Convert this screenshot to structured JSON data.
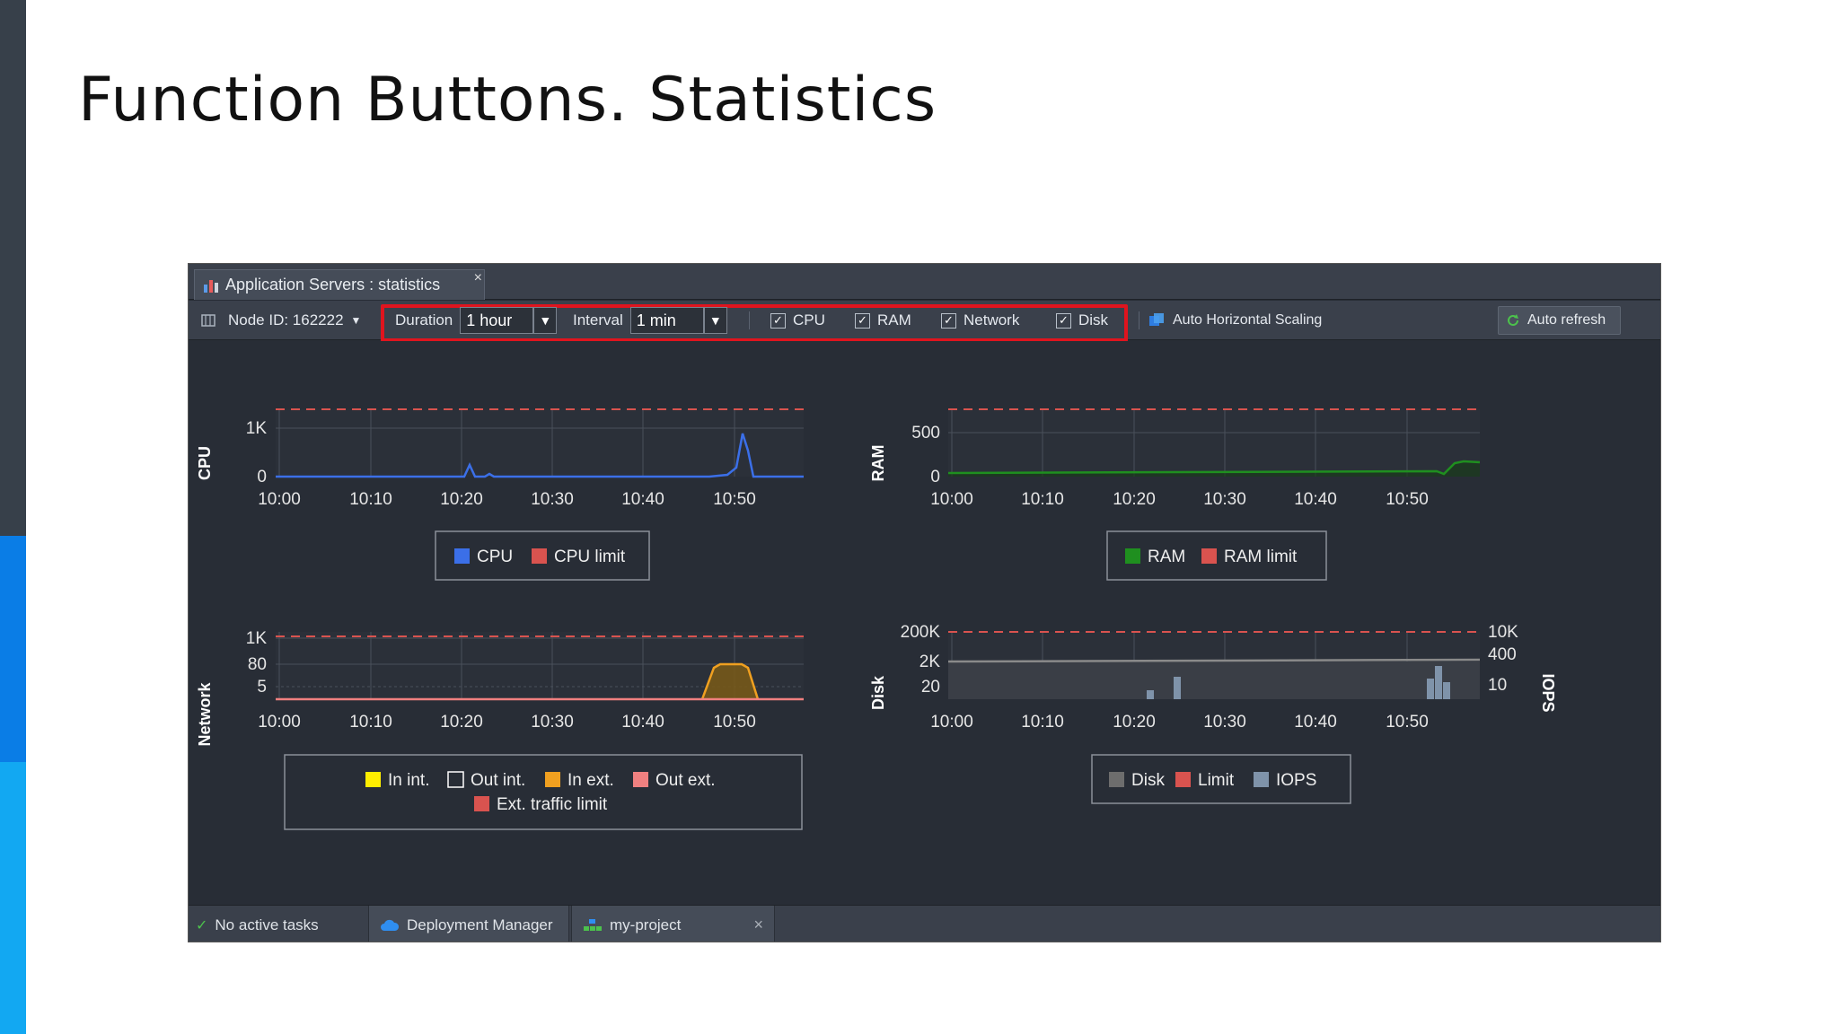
{
  "slide": {
    "title": "Function Buttons. Statistics"
  },
  "tab": {
    "label": "Application Servers : statistics",
    "close": "×"
  },
  "toolbar": {
    "node_label": "Node ID: 162222",
    "duration_label": "Duration",
    "duration_value": "1 hour",
    "interval_label": "Interval",
    "interval_value": "1 min",
    "checks": [
      "CPU",
      "RAM",
      "Network",
      "Disk"
    ],
    "scaling_label": "Auto Horizontal Scaling",
    "refresh_label": "Auto refresh"
  },
  "status": {
    "tasks": "No active tasks",
    "deploy": "Deployment Manager",
    "project": "my-project",
    "close": "×"
  },
  "colors": {
    "highlight": "#e0141e",
    "cpu": "#3b6fe8",
    "ram": "#1f8f1f",
    "limit": "#d9534f",
    "in_ext": "#f0a020",
    "in_int": "#ffee00",
    "iops": "#7f93aa",
    "disk": "#6d6d6d"
  },
  "chart_data": [
    {
      "type": "line",
      "ylabel": "CPU",
      "x": [
        "10:00",
        "10:10",
        "10:20",
        "10:30",
        "10:40",
        "10:50"
      ],
      "ticks_y": [
        "1K",
        "0"
      ],
      "series": [
        {
          "name": "CPU",
          "color": "#3b6fe8",
          "points": [
            [
              0,
              0
            ],
            [
              20,
              0
            ],
            [
              21,
              160
            ],
            [
              22,
              0
            ],
            [
              24,
              40
            ],
            [
              25,
              0
            ],
            [
              48,
              0
            ],
            [
              52,
              30
            ],
            [
              54,
              1000
            ],
            [
              55,
              0
            ],
            [
              58,
              0
            ]
          ]
        },
        {
          "name": "CPU limit",
          "color": "#d9534f",
          "style": "dashed"
        }
      ],
      "legend": [
        "CPU",
        "CPU limit"
      ]
    },
    {
      "type": "area",
      "ylabel": "RAM",
      "x": [
        "10:00",
        "10:10",
        "10:20",
        "10:30",
        "10:40",
        "10:50"
      ],
      "ticks_y": [
        "500",
        "0"
      ],
      "series": [
        {
          "name": "RAM",
          "color": "#1f8f1f"
        },
        {
          "name": "RAM limit",
          "color": "#d9534f",
          "style": "dashed"
        }
      ],
      "legend": [
        "RAM",
        "RAM limit"
      ]
    },
    {
      "type": "area",
      "ylabel": "Network",
      "x": [
        "10:00",
        "10:10",
        "10:20",
        "10:30",
        "10:40",
        "10:50"
      ],
      "ticks_y": [
        "1K",
        "80",
        "5"
      ],
      "series": [
        {
          "name": "In int.",
          "color": "#ffee00"
        },
        {
          "name": "Out int.",
          "color": "#ffffff"
        },
        {
          "name": "In ext.",
          "color": "#f0a020"
        },
        {
          "name": "Out ext.",
          "color": "#f08080"
        },
        {
          "name": "Ext. traffic limit",
          "color": "#d9534f",
          "style": "dashed"
        }
      ],
      "legend": [
        "In int.",
        "Out int.",
        "In ext.",
        "Out ext.",
        "Ext. traffic limit"
      ]
    },
    {
      "type": "bar",
      "ylabel": "Disk",
      "y2label": "IOPS",
      "x": [
        "10:00",
        "10:10",
        "10:20",
        "10:30",
        "10:40",
        "10:50"
      ],
      "ticks_y": [
        "200K",
        "2K",
        "20"
      ],
      "ticks_y2": [
        "10K",
        "400",
        "10"
      ],
      "series": [
        {
          "name": "Disk",
          "color": "#6d6d6d"
        },
        {
          "name": "Limit",
          "color": "#d9534f",
          "style": "dashed"
        },
        {
          "name": "IOPS",
          "color": "#7f93aa"
        }
      ],
      "legend": [
        "Disk",
        "Limit",
        "IOPS"
      ]
    }
  ]
}
